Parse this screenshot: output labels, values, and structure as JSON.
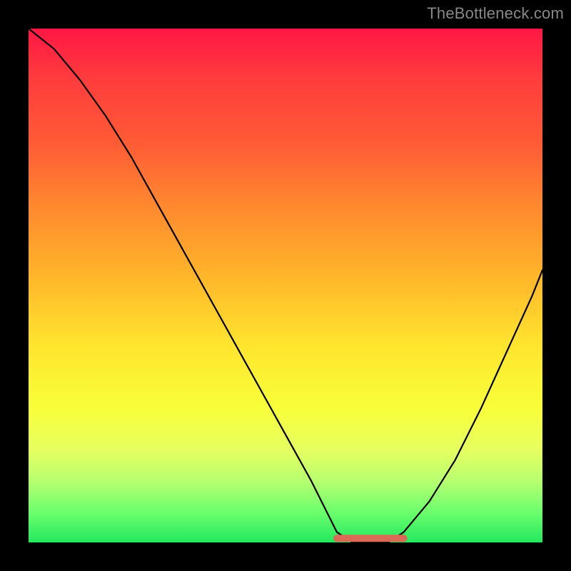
{
  "watermark": "TheBottleneck.com",
  "chart_data": {
    "type": "line",
    "title": "",
    "xlabel": "",
    "ylabel": "",
    "xlim": [
      0,
      100
    ],
    "ylim": [
      0,
      100
    ],
    "grid": false,
    "series": [
      {
        "name": "bottleneck-curve",
        "x": [
          0,
          5,
          10,
          15,
          20,
          25,
          30,
          35,
          40,
          45,
          50,
          55,
          58,
          60,
          63,
          67,
          70,
          73,
          78,
          83,
          88,
          93,
          98,
          100
        ],
        "y": [
          100,
          96,
          90,
          83,
          75,
          66,
          57,
          48,
          39,
          30,
          21,
          12,
          6,
          2,
          0,
          0,
          0,
          2,
          8,
          16,
          26,
          37,
          48,
          53
        ]
      },
      {
        "name": "optimal-range",
        "x": [
          60,
          73
        ],
        "y": [
          0.8,
          0.8
        ]
      }
    ],
    "colors": {
      "curve": "#000000",
      "optimal_range": "#d96a56",
      "gradient_top": "#ff1744",
      "gradient_bottom": "#24e85e"
    }
  }
}
